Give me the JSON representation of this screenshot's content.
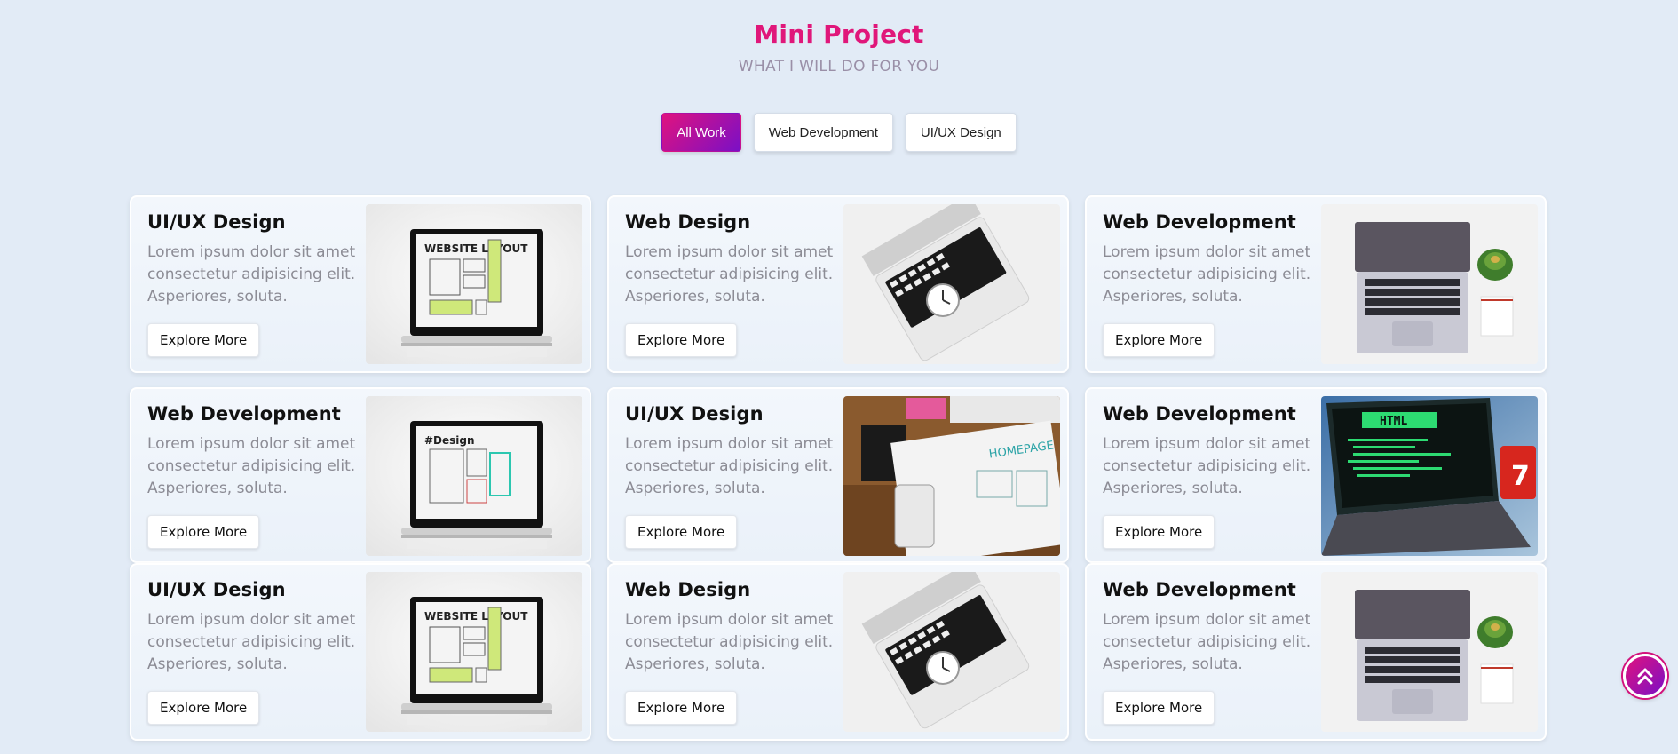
{
  "header": {
    "title": "Mini Project",
    "subtitle": "WHAT I WILL DO FOR YOU"
  },
  "filters": {
    "all": "All Work",
    "web": "Web Development",
    "uiux": "UI/UX Design",
    "active": "All Work"
  },
  "cards": [
    {
      "title": "UI/UX Design",
      "desc": "Lorem ipsum dolor sit amet consectetur adipisicing elit. Asperiores, soluta.",
      "button": "Explore More",
      "image": "website-layout-laptop",
      "image_text": "WEBSITE LAYOUT"
    },
    {
      "title": "Web Design",
      "desc": "Lorem ipsum dolor sit amet consectetur adipisicing elit. Asperiores, soluta.",
      "button": "Explore More",
      "image": "laptop-with-clock"
    },
    {
      "title": "Web Development",
      "desc": "Lorem ipsum dolor sit amet consectetur adipisicing elit. Asperiores, soluta.",
      "button": "Explore More",
      "image": "laptop-with-plant"
    },
    {
      "title": "Web Development",
      "desc": "Lorem ipsum dolor sit amet consectetur adipisicing elit. Asperiores, soluta.",
      "button": "Explore More",
      "image": "design-laptop",
      "image_text": "#Design"
    },
    {
      "title": "UI/UX Design",
      "desc": "Lorem ipsum dolor sit amet consectetur adipisicing elit. Asperiores, soluta.",
      "button": "Explore More",
      "image": "homepage-sketch-desk",
      "image_text": "HOMEPAGE"
    },
    {
      "title": "Web Development",
      "desc": "Lorem ipsum dolor sit amet consectetur adipisicing elit. Asperiores, soluta.",
      "button": "Explore More",
      "image": "html-code-laptop",
      "image_text": "HTML"
    },
    {
      "title": "UI/UX Design",
      "desc": "Lorem ipsum dolor sit amet consectetur adipisicing elit. Asperiores, soluta.",
      "button": "Explore More",
      "image": "website-layout-laptop",
      "image_text": "WEBSITE LAYOUT"
    },
    {
      "title": "Web Design",
      "desc": "Lorem ipsum dolor sit amet consectetur adipisicing elit. Asperiores, soluta.",
      "button": "Explore More",
      "image": "laptop-with-clock"
    },
    {
      "title": "Web Development",
      "desc": "Lorem ipsum dolor sit amet consectetur adipisicing elit. Asperiores, soluta.",
      "button": "Explore More",
      "image": "laptop-with-plant"
    }
  ],
  "scroll_top": {
    "icon": "double-chevron-up-icon"
  },
  "colors": {
    "accent_pink": "#e0177a",
    "accent_purple": "#7a10c6",
    "background": "#e2ebf6"
  }
}
